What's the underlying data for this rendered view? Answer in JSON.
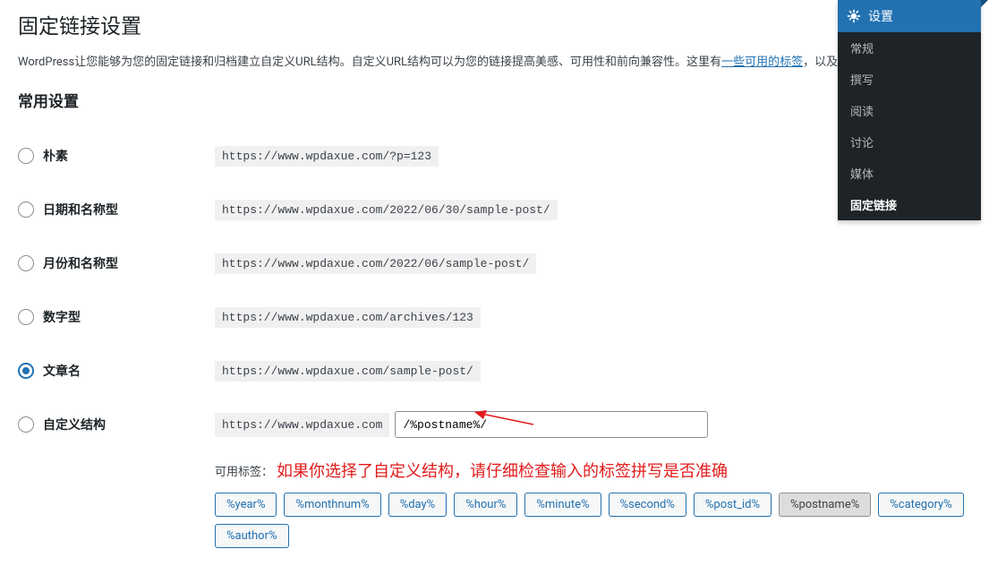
{
  "page": {
    "title": "固定链接设置",
    "description_before": "WordPress让您能够为您的固定链接和归档建立自定义URL结构。自定义URL结构可以为您的链接提高美感、可用性和前向兼容性。这里有",
    "description_link": "一些可用的标签",
    "description_after": "，以及一",
    "section_title": "常用设置"
  },
  "options": [
    {
      "label": "朴素",
      "example": "https://www.wpdaxue.com/?p=123",
      "checked": false
    },
    {
      "label": "日期和名称型",
      "example": "https://www.wpdaxue.com/2022/06/30/sample-post/",
      "checked": false
    },
    {
      "label": "月份和名称型",
      "example": "https://www.wpdaxue.com/2022/06/sample-post/",
      "checked": false
    },
    {
      "label": "数字型",
      "example": "https://www.wpdaxue.com/archives/123",
      "checked": false
    },
    {
      "label": "文章名",
      "example": "https://www.wpdaxue.com/sample-post/",
      "checked": true
    },
    {
      "label": "自定义结构",
      "url_prefix": "https://www.wpdaxue.com",
      "input_value": "/%postname%/",
      "checked": false
    }
  ],
  "tags": {
    "label": "可用标签：",
    "annotation": "如果你选择了自定义结构，请仔细检查输入的标签拼写是否准确",
    "items": [
      "%year%",
      "%monthnum%",
      "%day%",
      "%hour%",
      "%minute%",
      "%second%",
      "%post_id%",
      "%postname%",
      "%category%",
      "%author%"
    ],
    "active_index": 7
  },
  "flyout": {
    "header": "设置",
    "items": [
      "常规",
      "撰写",
      "阅读",
      "讨论",
      "媒体",
      "固定链接"
    ],
    "active_index": 5
  }
}
